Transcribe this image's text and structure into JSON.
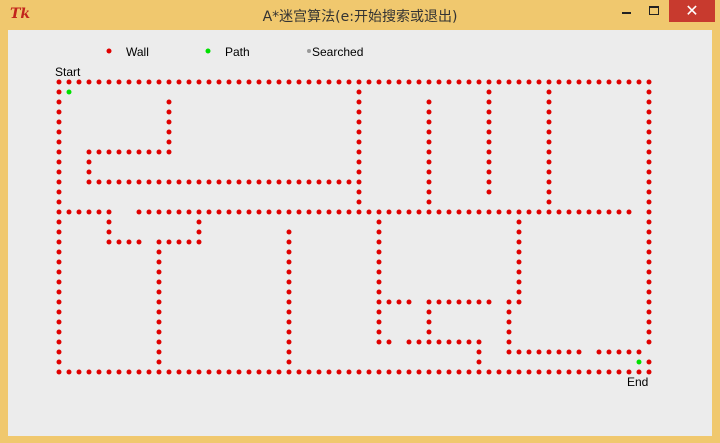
{
  "window": {
    "logo_text": "Tk",
    "title": "A*迷宫算法(e:开始搜索或退出)",
    "close_glyph": "✕"
  },
  "legend": [
    {
      "label": "Wall",
      "color": "#e00000"
    },
    {
      "label": "Path",
      "color": "#00e000"
    },
    {
      "label": "Searched",
      "color": "#999999"
    }
  ],
  "labels": {
    "start": "Start",
    "end": "End"
  },
  "colors": {
    "wall": "#e00000",
    "path": "#00e000",
    "searched": "#999999"
  },
  "maze": {
    "wall_segments": [
      [
        0,
        0,
        59,
        0
      ],
      [
        0,
        0,
        0,
        29
      ],
      [
        59,
        0,
        59,
        29
      ],
      [
        0,
        29,
        59,
        29
      ],
      [
        0,
        13,
        5,
        13
      ],
      [
        8,
        13,
        57,
        13
      ],
      [
        3,
        7,
        11,
        7
      ],
      [
        3,
        7,
        3,
        10
      ],
      [
        3,
        10,
        30,
        10
      ],
      [
        11,
        2,
        11,
        7
      ],
      [
        30,
        0,
        30,
        13
      ],
      [
        37,
        2,
        37,
        13
      ],
      [
        43,
        0,
        43,
        11
      ],
      [
        49,
        1,
        49,
        13
      ],
      [
        5,
        13,
        5,
        16
      ],
      [
        5,
        16,
        8,
        16
      ],
      [
        14,
        13,
        14,
        16
      ],
      [
        10,
        16,
        14,
        16
      ],
      [
        10,
        16,
        10,
        28
      ],
      [
        23,
        15,
        23,
        29
      ],
      [
        32,
        14,
        32,
        26
      ],
      [
        32,
        26,
        33,
        26
      ],
      [
        32,
        22,
        35,
        22
      ],
      [
        37,
        22,
        43,
        22
      ],
      [
        37,
        22,
        37,
        26
      ],
      [
        35,
        26,
        42,
        26
      ],
      [
        42,
        26,
        42,
        29
      ],
      [
        46,
        14,
        46,
        22
      ],
      [
        45,
        22,
        45,
        27
      ],
      [
        45,
        27,
        52,
        27
      ],
      [
        54,
        27,
        59,
        27
      ]
    ],
    "wall_gaps": [
      [
        59,
        27
      ]
    ],
    "path_cells": [
      [
        1,
        1
      ],
      [
        58,
        28
      ]
    ],
    "start_cell": [
      0,
      0
    ],
    "end_cell": [
      59,
      29
    ]
  }
}
